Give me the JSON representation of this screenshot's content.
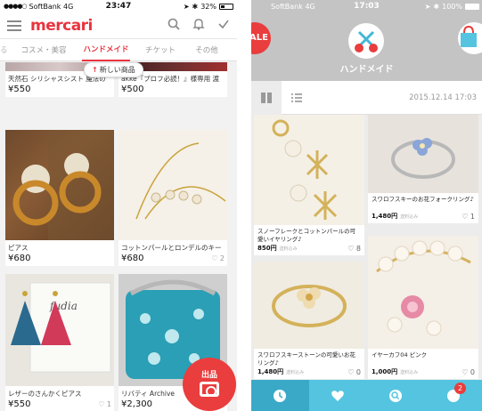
{
  "left": {
    "status": {
      "carrier": "SoftBank",
      "network": "4G",
      "time": "23:47",
      "battery": "32%"
    },
    "app": {
      "logo": "mercari"
    },
    "tabs": [
      "コスメ・美容",
      "ハンドメイド",
      "チケット",
      "その他"
    ],
    "active_tab": "ハンドメイド",
    "new_items_label": "新しい商品",
    "items": [
      {
        "title": "天然石 シリシャスシスト 魔法の",
        "price": "¥550",
        "likes": ""
      },
      {
        "title": "akke『プロフ必読！』様専用 渡",
        "price": "¥500",
        "likes": ""
      },
      {
        "title": "ピアス",
        "price": "¥680",
        "likes": ""
      },
      {
        "title": "コットンパールとロンデルのキー",
        "price": "¥680",
        "likes": "2"
      },
      {
        "title": "レザーのさんかくピアス",
        "price": "¥550",
        "likes": "1"
      },
      {
        "title": "リバティ Archive",
        "price": "¥2,300",
        "likes": ""
      }
    ],
    "sell_button": "出品",
    "card_image_text": "fudia"
  },
  "right": {
    "status": {
      "carrier": "SoftBank",
      "network": "4G",
      "time": "17:03",
      "battery": "100%"
    },
    "sale_label": "ALE",
    "category_title": "ハンドメイド",
    "date": "2015.12.14 17:03",
    "items": [
      {
        "title": "スノーフレークとコットンパールの可愛いイヤリング♪",
        "price": "850円",
        "shipping": "送料込み",
        "likes": "8"
      },
      {
        "title": "スワロフスキーのお花フォークリング♪",
        "price": "1,480円",
        "shipping": "送料込み",
        "likes": "1"
      },
      {
        "title": "スワロフスキーストーンの可愛いお花リング♪",
        "price": "1,480円",
        "shipping": "送料込み",
        "likes": "0"
      },
      {
        "title": "イヤーカフ04 ピンク",
        "price": "1,000円",
        "shipping": "送料込み",
        "likes": "0"
      }
    ],
    "nav_badge": "2"
  }
}
